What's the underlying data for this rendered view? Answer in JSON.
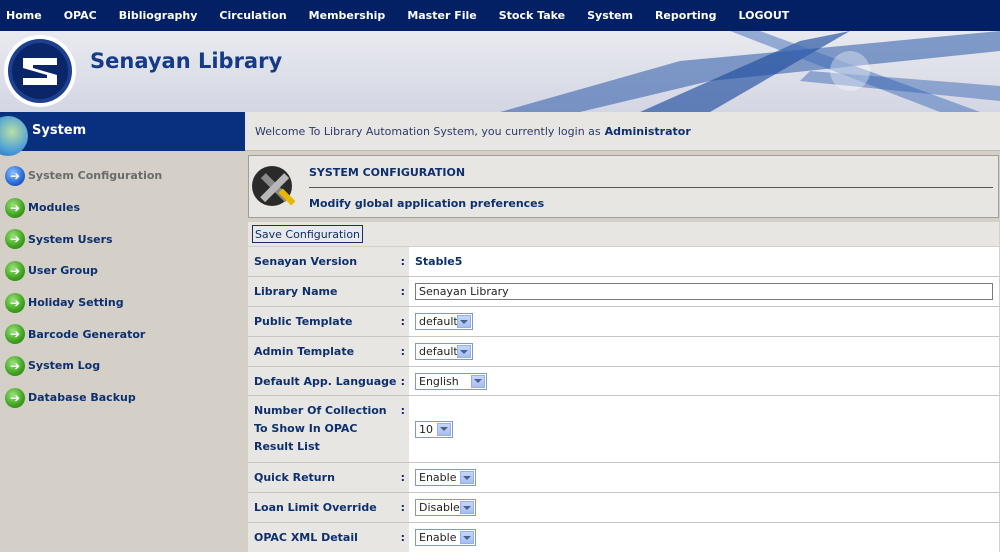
{
  "nav": {
    "items": [
      "Home",
      "OPAC",
      "Bibliography",
      "Circulation",
      "Membership",
      "Master File",
      "Stock Take",
      "System",
      "Reporting",
      "LOGOUT"
    ]
  },
  "banner": {
    "title": "Senayan Library"
  },
  "sidebar": {
    "title": "System",
    "items": [
      {
        "label": "System Configuration",
        "active": true
      },
      {
        "label": "Modules"
      },
      {
        "label": "System Users"
      },
      {
        "label": "User Group"
      },
      {
        "label": "Holiday Setting"
      },
      {
        "label": "Barcode Generator"
      },
      {
        "label": "System Log"
      },
      {
        "label": "Database Backup"
      }
    ]
  },
  "welcome": {
    "text": "Welcome To Library Automation System, you currently login as",
    "user": "Administrator"
  },
  "info": {
    "title": "SYSTEM CONFIGURATION",
    "description": "Modify global application preferences"
  },
  "form": {
    "save_label": "Save Configuration",
    "colon": ":",
    "rows": {
      "version": {
        "label": "Senayan Version",
        "value": "Stable5"
      },
      "library_name": {
        "label": "Library Name",
        "value": "Senayan Library"
      },
      "public_template": {
        "label": "Public Template",
        "value": "default"
      },
      "admin_template": {
        "label": "Admin Template",
        "value": "default"
      },
      "language": {
        "label": "Default App. Language",
        "value": "English"
      },
      "num_collection": {
        "label": "Number Of Collection To Show In OPAC Result List",
        "value": "10"
      },
      "quick_return": {
        "label": "Quick Return",
        "value": "Enable"
      },
      "loan_limit": {
        "label": "Loan Limit Override",
        "value": "Disable"
      },
      "opac_xml": {
        "label": "OPAC XML Detail",
        "value": "Enable"
      }
    }
  },
  "colors": {
    "nav_bg": "#022063",
    "accent": "#0d2f6e",
    "sidebar_header": "#08307f",
    "panel_bg": "#d4d0c8"
  }
}
